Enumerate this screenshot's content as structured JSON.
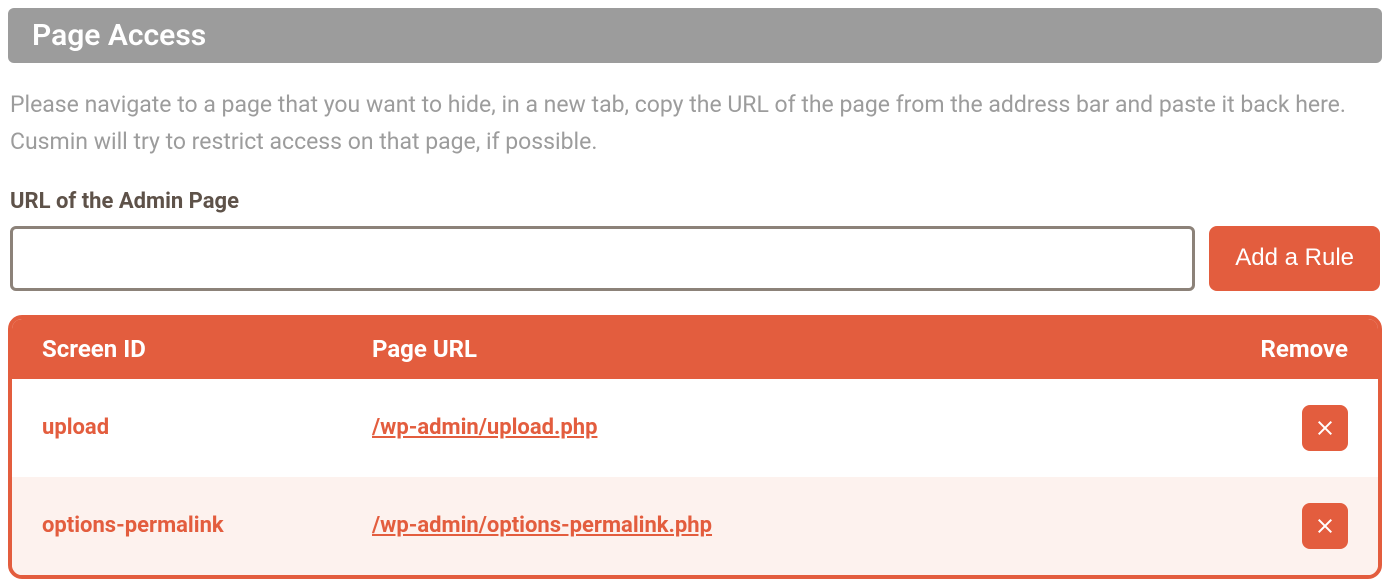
{
  "header": {
    "title": "Page Access"
  },
  "description": "Please navigate to a page that you want to hide, in a new tab, copy the URL of the page from the address bar and paste it back here. Cusmin will try to restrict access on that page, if possible.",
  "form": {
    "label": "URL of the Admin Page",
    "input_value": "",
    "add_button_label": "Add a Rule"
  },
  "table": {
    "columns": {
      "screen_id": "Screen ID",
      "page_url": "Page URL",
      "remove": "Remove"
    },
    "rows": [
      {
        "screen_id": "upload",
        "page_url": "/wp-admin/upload.php"
      },
      {
        "screen_id": "options-permalink",
        "page_url": "/wp-admin/options-permalink.php"
      }
    ]
  }
}
